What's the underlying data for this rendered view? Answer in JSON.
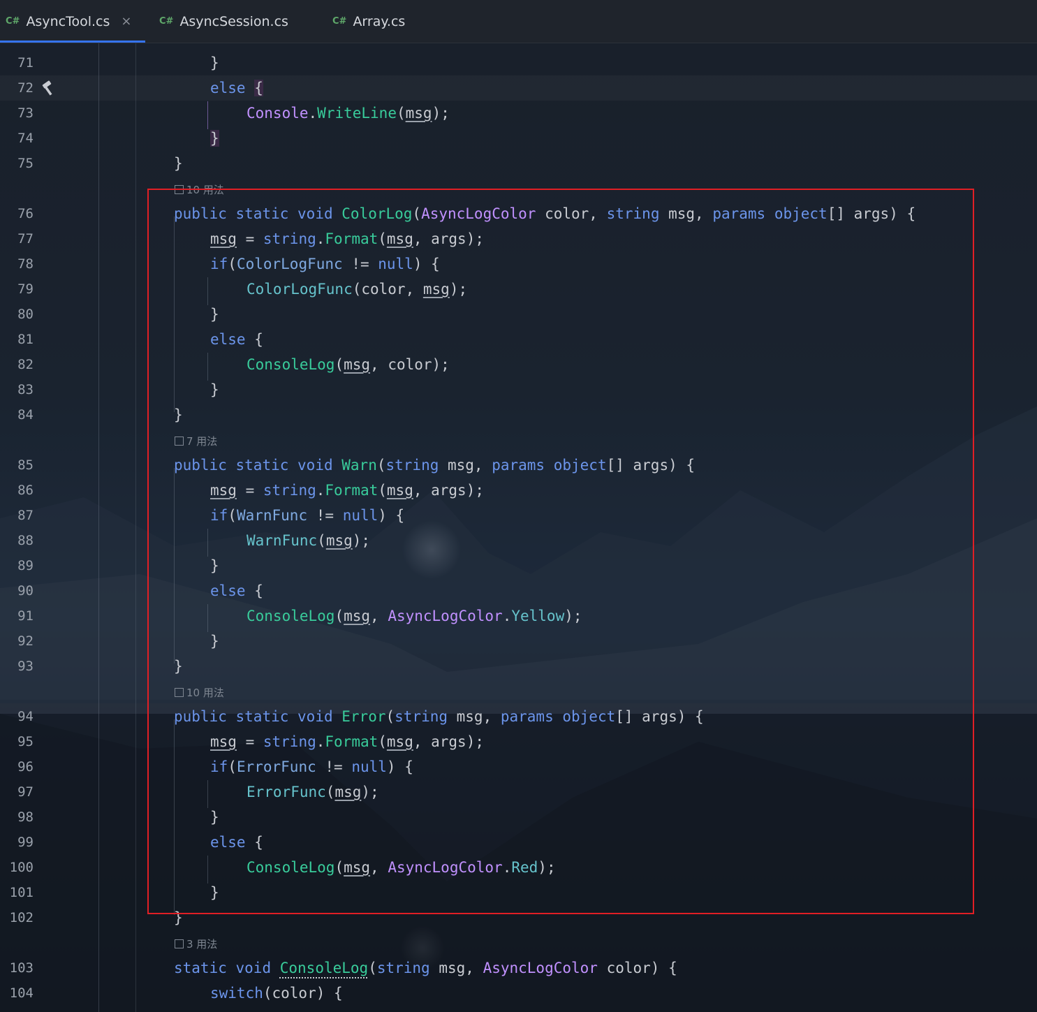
{
  "tabs": [
    {
      "icon": "C#",
      "label": "AsyncTool.cs",
      "active": true,
      "closable": true
    },
    {
      "icon": "C#",
      "label": "AsyncSession.cs",
      "active": false
    },
    {
      "icon": "C#",
      "label": "Array.cs",
      "active": false
    }
  ],
  "close_glyph": "×",
  "usage_hints": {
    "h76": "10 用法",
    "h85": "7 用法",
    "h94": "10 用法",
    "h103": "3 用法"
  },
  "line_numbers": [
    "71",
    "72",
    "73",
    "74",
    "75",
    "76",
    "77",
    "78",
    "79",
    "80",
    "81",
    "82",
    "83",
    "84",
    "85",
    "86",
    "87",
    "88",
    "89",
    "90",
    "91",
    "92",
    "93",
    "94",
    "95",
    "96",
    "97",
    "98",
    "99",
    "100",
    "101",
    "102",
    "103",
    "104"
  ],
  "code": {
    "l71": "}",
    "l72_kw": "else",
    "l72_brace": "{",
    "l73": [
      "Console",
      ".",
      "WriteLine",
      "(",
      "msg",
      ");"
    ],
    "l74": "}",
    "l75": "}",
    "l76": [
      "public",
      "static",
      "void",
      "ColorLog",
      "(",
      "AsyncLogColor",
      " color, ",
      "string",
      " msg, ",
      "params",
      "object",
      "[] args) {"
    ],
    "l77": [
      "msg",
      " = ",
      "string",
      ".",
      "Format",
      "(",
      "msg",
      ", args);"
    ],
    "l78": [
      "if",
      "(",
      "ColorLogFunc",
      " != ",
      "null",
      ") {"
    ],
    "l79": [
      "ColorLogFunc",
      "(color, ",
      "msg",
      ");"
    ],
    "l80": "}",
    "l81": [
      "else",
      " {"
    ],
    "l82": [
      "ConsoleLog",
      "(",
      "msg",
      ", color);"
    ],
    "l83": "}",
    "l84": "}",
    "l85": [
      "public",
      "static",
      "void",
      "Warn",
      "(",
      "string",
      " msg, ",
      "params",
      "object",
      "[] args) {"
    ],
    "l86": [
      "msg",
      " = ",
      "string",
      ".",
      "Format",
      "(",
      "msg",
      ", args);"
    ],
    "l87": [
      "if",
      "(",
      "WarnFunc",
      " != ",
      "null",
      ") {"
    ],
    "l88": [
      "WarnFunc",
      "(",
      "msg",
      ");"
    ],
    "l89": "}",
    "l90": [
      "else",
      " {"
    ],
    "l91": [
      "ConsoleLog",
      "(",
      "msg",
      ", ",
      "AsyncLogColor",
      ".",
      "Yellow",
      ");"
    ],
    "l92": "}",
    "l93": "}",
    "l94": [
      "public",
      "static",
      "void",
      "Error",
      "(",
      "string",
      " msg, ",
      "params",
      "object",
      "[] args) {"
    ],
    "l95": [
      "msg",
      " = ",
      "string",
      ".",
      "Format",
      "(",
      "msg",
      ", args);"
    ],
    "l96": [
      "if",
      "(",
      "ErrorFunc",
      " != ",
      "null",
      ") {"
    ],
    "l97": [
      "ErrorFunc",
      "(",
      "msg",
      ");"
    ],
    "l98": "}",
    "l99": [
      "else",
      " {"
    ],
    "l100": [
      "ConsoleLog",
      "(",
      "msg",
      ", ",
      "AsyncLogColor",
      ".",
      "Red",
      ");"
    ],
    "l101": "}",
    "l102": "}",
    "l103": [
      "static",
      "void",
      "ConsoleLog",
      "(",
      "string",
      " msg, ",
      "AsyncLogColor",
      " color) {"
    ],
    "l104": [
      "switch",
      "(color) {"
    ]
  },
  "colors": {
    "keyword": "#6c95eb",
    "method": "#39cc9b",
    "type": "#c191ff",
    "highlight_box": "#e01f25",
    "tab_underline": "#3574f0"
  }
}
